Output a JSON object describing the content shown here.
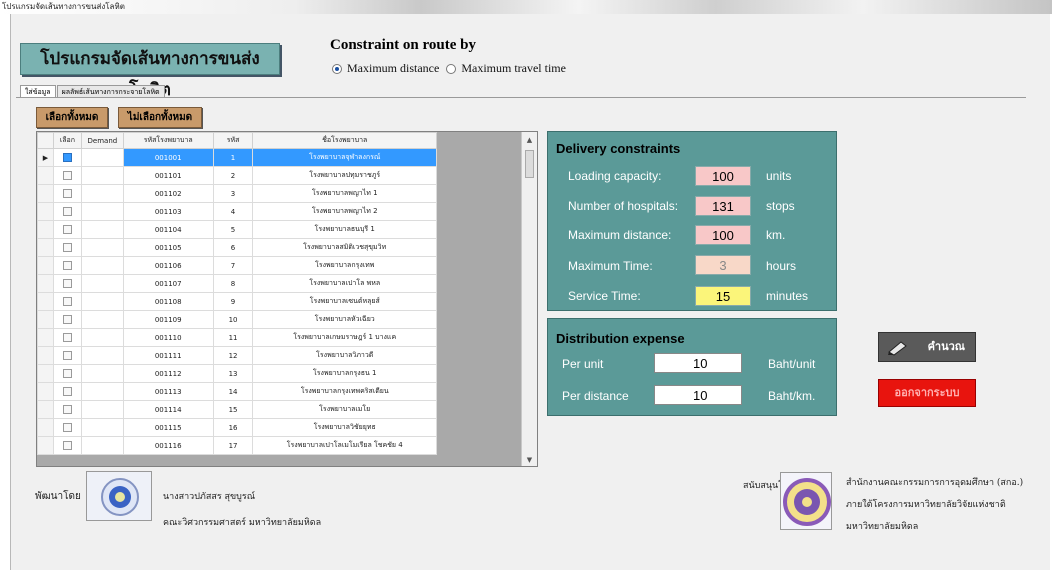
{
  "window": {
    "title": "โปรแกรมจัดเส้นทางการขนส่งโลหิต"
  },
  "header": {
    "program_title": "โปรแกรมจัดเส้นทางการขนส่งโลหิต",
    "constraint_title": "Constraint on route by",
    "options": [
      {
        "label": "Maximum distance",
        "selected": true
      },
      {
        "label": "Maximum travel time",
        "selected": false
      }
    ]
  },
  "tabs": [
    {
      "label": "ใส่ข้อมูล",
      "active": true
    },
    {
      "label": "ผลลัพธ์เส้นทางการกระจายโลหิต",
      "active": false
    }
  ],
  "toolbar": {
    "select_all": "เลือกทั้งหมด",
    "deselect_all": "ไม่เลือกทั้งหมด"
  },
  "grid": {
    "columns": [
      "เลือก",
      "Demand",
      "รหัสโรงพยาบาล",
      "รหัส",
      "ชื่อโรงพยาบาล"
    ],
    "rows": [
      {
        "id": "001001",
        "num": "1",
        "name": "โรงพยาบาลจุฬาลงกรณ์"
      },
      {
        "id": "001101",
        "num": "2",
        "name": "โรงพยาบาลปทุมราชภูร์"
      },
      {
        "id": "001102",
        "num": "3",
        "name": "โรงพยาบาลพญาไท 1"
      },
      {
        "id": "001103",
        "num": "4",
        "name": "โรงพยาบาลพญาไท 2"
      },
      {
        "id": "001104",
        "num": "5",
        "name": "โรงพยาบาลธนบุรี 1"
      },
      {
        "id": "001105",
        "num": "6",
        "name": "โรงพยาบาลสมิติเวชสุขุมวิท"
      },
      {
        "id": "001106",
        "num": "7",
        "name": "โรงพยาบาลกรุงเทพ"
      },
      {
        "id": "001107",
        "num": "8",
        "name": "โรงพยาบาลเปาโล พหล"
      },
      {
        "id": "001108",
        "num": "9",
        "name": "โรงพยาบาลเซนต์หลุยส์"
      },
      {
        "id": "001109",
        "num": "10",
        "name": "โรงพยาบาลหัวเฉียว"
      },
      {
        "id": "001110",
        "num": "11",
        "name": "โรงพยาบาลเกษมราษฎร์ 1 บางแค"
      },
      {
        "id": "001111",
        "num": "12",
        "name": "โรงพยาบาลวิภาวดี"
      },
      {
        "id": "001112",
        "num": "13",
        "name": "โรงพยาบาลกรุงธน 1"
      },
      {
        "id": "001113",
        "num": "14",
        "name": "โรงพยาบาลกรุงเทพคริสเตียน"
      },
      {
        "id": "001114",
        "num": "15",
        "name": "โรงพยาบาลเมโย"
      },
      {
        "id": "001115",
        "num": "16",
        "name": "โรงพยาบาลวิชัยยุทธ"
      },
      {
        "id": "001116",
        "num": "17",
        "name": "โรงพยาบาลเปาโลเมโมเรียล โชคชัย 4"
      }
    ]
  },
  "delivery": {
    "title": "Delivery constraints",
    "fields": [
      {
        "label": "Loading capacity:",
        "value": "100",
        "unit": "units",
        "color": "#f8c8c8"
      },
      {
        "label": "Number of hospitals:",
        "value": "131",
        "unit": "stops",
        "color": "#f8c8c8"
      },
      {
        "label": "Maximum distance:",
        "value": "100",
        "unit": "km.",
        "color": "#f8c8c8"
      },
      {
        "label": "Maximum Time:",
        "value": "3",
        "unit": "hours",
        "color": "#f8d8c8"
      },
      {
        "label": "Service Time:",
        "value": "15",
        "unit": "minutes",
        "color": "#fbf57a"
      }
    ]
  },
  "expense": {
    "title": "Distribution expense",
    "fields": [
      {
        "label": "Per unit",
        "value": "10",
        "unit": "Baht/unit"
      },
      {
        "label": "Per distance",
        "value": "10",
        "unit": "Baht/km."
      }
    ]
  },
  "actions": {
    "calculate": "คำนวณ",
    "exit": "ออกจากระบบ"
  },
  "footer": {
    "developed_by": "พัฒนาโดย",
    "developer_name": "นางสาวปภัสสร สุขบูรณ์",
    "developer_faculty": "คณะวิศวกรรมศาสตร์ มหาวิทยาลัยมหิดล",
    "supported_by": "สนับสนุนโดย",
    "sponsor_lines": [
      "สำนักงานคณะกรรมการการอุดมศึกษา (สกอ.)",
      "ภายใต้โครงการมหาวิทยาลัยวิจัยแห่งชาติ",
      "มหาวิทยาลัยมหิดล"
    ]
  }
}
